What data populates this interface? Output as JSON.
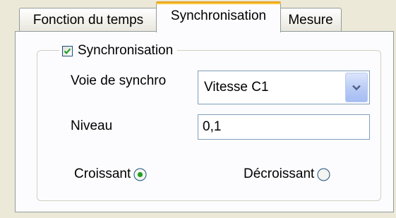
{
  "tabs": [
    {
      "label": "Fonction du temps",
      "selected": false
    },
    {
      "label": "Synchronisation",
      "selected": true
    },
    {
      "label": "Mesure",
      "selected": false
    }
  ],
  "group": {
    "label": "Synchronisation",
    "checked": true
  },
  "fields": {
    "voie_label": "Voie de synchro",
    "voie_value": "Vitesse C1",
    "niveau_label": "Niveau",
    "niveau_value": "0,1"
  },
  "radios": {
    "croissant_label": "Croissant",
    "croissant_selected": true,
    "decroissant_label": "Décroissant",
    "decroissant_selected": false
  },
  "colors": {
    "selected_tab_accent": "#ffc83c",
    "radio_dot": "#21a121",
    "checkmark": "#21a121"
  }
}
